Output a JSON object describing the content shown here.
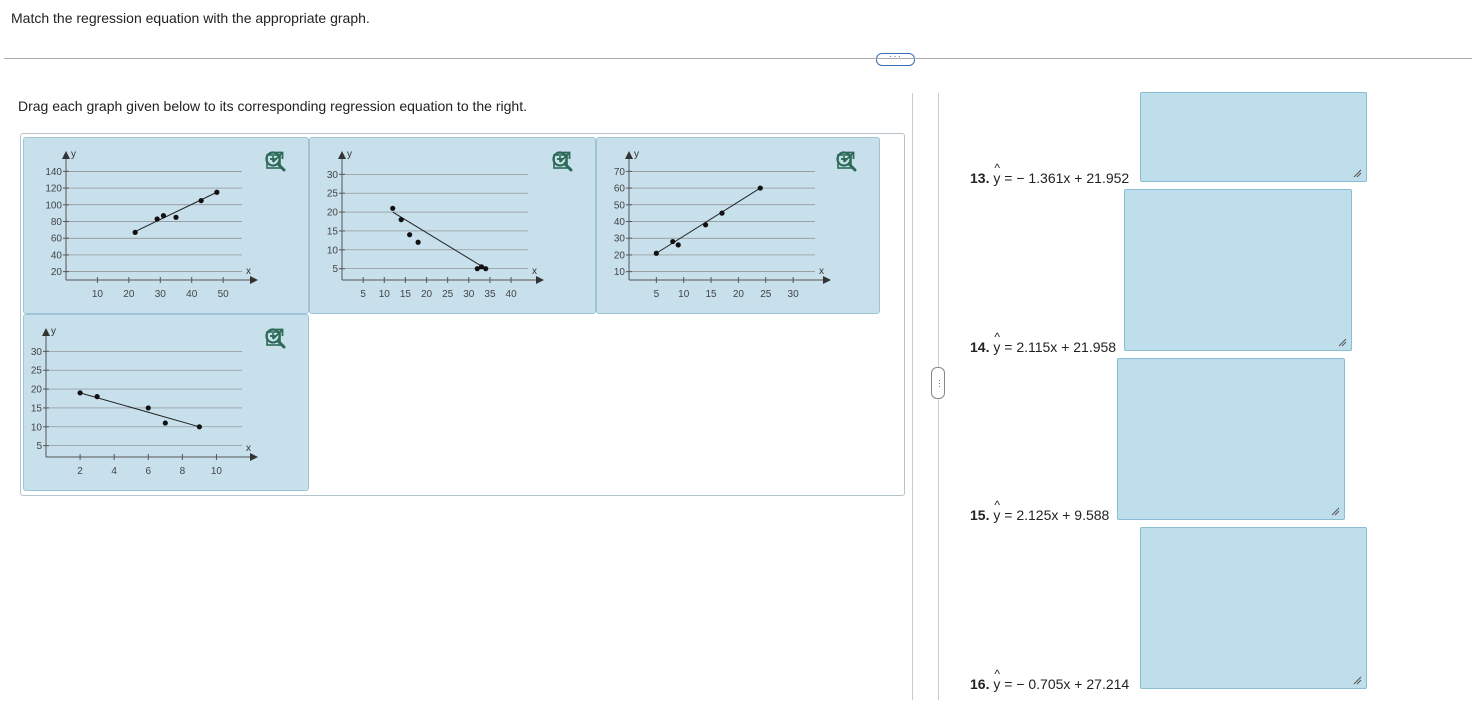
{
  "header": {
    "instruction": "Match the regression equation with the appropriate graph.",
    "more_label": "···",
    "drag_instruction": "Drag each graph given below to its corresponding regression equation to the right."
  },
  "divider": {
    "grip_label": "···"
  },
  "graphs": [
    {
      "xticks": [
        "10",
        "20",
        "30",
        "40",
        "50"
      ],
      "yticks": [
        "140",
        "120",
        "100",
        "80",
        "60",
        "40",
        "20"
      ],
      "xlabel": "x",
      "ylabel": "y"
    },
    {
      "xticks": [
        "5",
        "10",
        "15",
        "20",
        "25",
        "30",
        "35",
        "40"
      ],
      "yticks": [
        "30",
        "25",
        "20",
        "15",
        "10",
        "5"
      ],
      "xlabel": "x",
      "ylabel": "y"
    },
    {
      "xticks": [
        "5",
        "10",
        "15",
        "20",
        "25",
        "30"
      ],
      "yticks": [
        "70",
        "60",
        "50",
        "40",
        "30",
        "20",
        "10"
      ],
      "xlabel": "x",
      "ylabel": "y"
    },
    {
      "xticks": [
        "2",
        "4",
        "6",
        "8",
        "10"
      ],
      "yticks": [
        "30",
        "25",
        "20",
        "15",
        "10",
        "5"
      ],
      "xlabel": "x",
      "ylabel": "y"
    }
  ],
  "chart_data": [
    {
      "type": "scatter",
      "xlim": [
        0,
        56
      ],
      "ylim": [
        10,
        150
      ],
      "points": [
        [
          22,
          67
        ],
        [
          29,
          83
        ],
        [
          31,
          87
        ],
        [
          35,
          85
        ],
        [
          43,
          105
        ],
        [
          48,
          115
        ]
      ],
      "fit_line": [
        [
          22,
          68
        ],
        [
          48,
          115
        ]
      ],
      "xlabel": "x",
      "ylabel": "y"
    },
    {
      "type": "scatter",
      "xlim": [
        0,
        44
      ],
      "ylim": [
        2,
        33
      ],
      "points": [
        [
          12,
          21
        ],
        [
          14,
          18
        ],
        [
          16,
          14
        ],
        [
          18,
          12
        ],
        [
          32,
          5
        ],
        [
          33,
          5.5
        ],
        [
          34,
          5
        ]
      ],
      "fit_line": [
        [
          12,
          20
        ],
        [
          34,
          5
        ]
      ],
      "xlabel": "x",
      "ylabel": "y"
    },
    {
      "type": "scatter",
      "xlim": [
        0,
        34
      ],
      "ylim": [
        5,
        75
      ],
      "points": [
        [
          5,
          21
        ],
        [
          8,
          28
        ],
        [
          9,
          26
        ],
        [
          14,
          38
        ],
        [
          17,
          45
        ],
        [
          24,
          60
        ]
      ],
      "fit_line": [
        [
          5,
          21
        ],
        [
          24,
          60
        ]
      ],
      "xlabel": "x",
      "ylabel": "y"
    },
    {
      "type": "scatter",
      "xlim": [
        0,
        11.5
      ],
      "ylim": [
        2,
        33
      ],
      "points": [
        [
          2,
          19
        ],
        [
          3,
          18
        ],
        [
          6,
          15
        ],
        [
          7,
          11
        ],
        [
          9,
          10
        ]
      ],
      "fit_line": [
        [
          2,
          19
        ],
        [
          9,
          10
        ]
      ],
      "xlabel": "x",
      "ylabel": "y"
    }
  ],
  "equations": [
    {
      "number": "13.",
      "yhat": "y",
      "rhs": "= − 1.361x + 21.952"
    },
    {
      "number": "14.",
      "yhat": "y",
      "rhs": "= 2.115x + 21.958"
    },
    {
      "number": "15.",
      "yhat": "y",
      "rhs": "= 2.125x + 9.588"
    },
    {
      "number": "16.",
      "yhat": "y",
      "rhs": "= − 0.705x + 27.214"
    }
  ],
  "icons": {
    "zoom_in": "zoom-in-icon",
    "zoom_out": "zoom-out-icon",
    "popout": "popout-icon"
  },
  "colors": {
    "card_border": "#c7e0ec",
    "drop_fill": "#bddeea",
    "icon": "#2d6a57"
  }
}
